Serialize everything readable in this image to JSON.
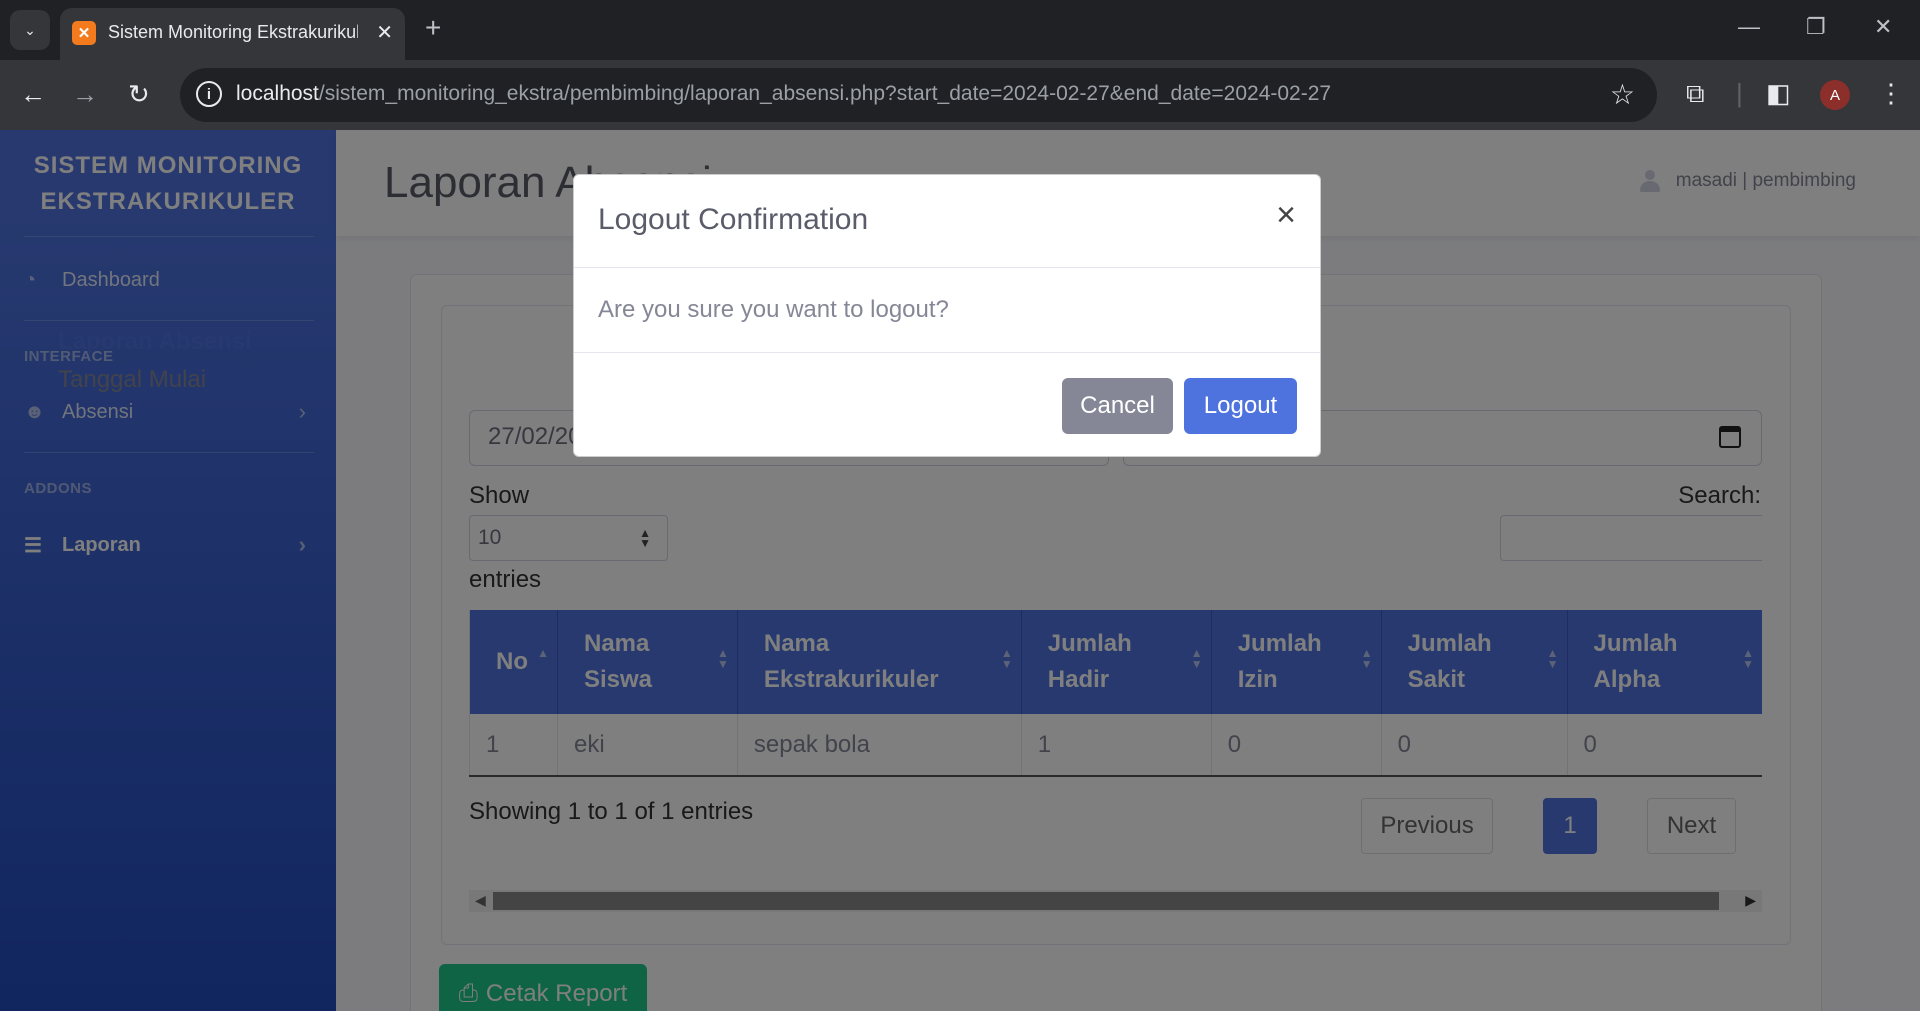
{
  "browser": {
    "tab_title": "Sistem Monitoring Ekstrakurikuler",
    "url_host": "localhost",
    "url_path": "/sistem_monitoring_ekstra/pembimbing/laporan_absensi.php?start_date=2024-02-27&end_date=2024-02-27",
    "profile_initial": "A"
  },
  "sidebar": {
    "brand_line1": "SISTEM MONITORING",
    "brand_line2": "EKSTRAKURIKULER",
    "dashboard": "Dashboard",
    "heading_interface": "INTERFACE",
    "absensi": "Absensi",
    "heading_addons": "ADDONS",
    "laporan": "Laporan"
  },
  "topbar": {
    "page_title": "Laporan Absensi",
    "user": "masadi | pembimbing"
  },
  "report": {
    "section_title": "Laporan Absensi",
    "date_label": "Tanggal Mulai",
    "start_date_value": "27/02/2024",
    "show_label": "Show",
    "length_value": "10",
    "entries_label": "entries",
    "search_label": "Search:"
  },
  "table": {
    "headers": [
      "No",
      "Nama Siswa",
      "Nama Ekstrakurikuler",
      "Jumlah Hadir",
      "Jumlah Izin",
      "Jumlah Sakit",
      "Jumlah Alpha"
    ],
    "rows": [
      [
        "1",
        "eki",
        "sepak bola",
        "1",
        "0",
        "0",
        "0"
      ]
    ]
  },
  "pagination": {
    "info": "Showing 1 to 1 of 1 entries",
    "previous": "Previous",
    "current": "1",
    "next": "Next"
  },
  "print_button": "Cetak Report",
  "modal": {
    "title": "Logout Confirmation",
    "body": "Are you sure you want to logout?",
    "cancel": "Cancel",
    "logout": "Logout"
  }
}
